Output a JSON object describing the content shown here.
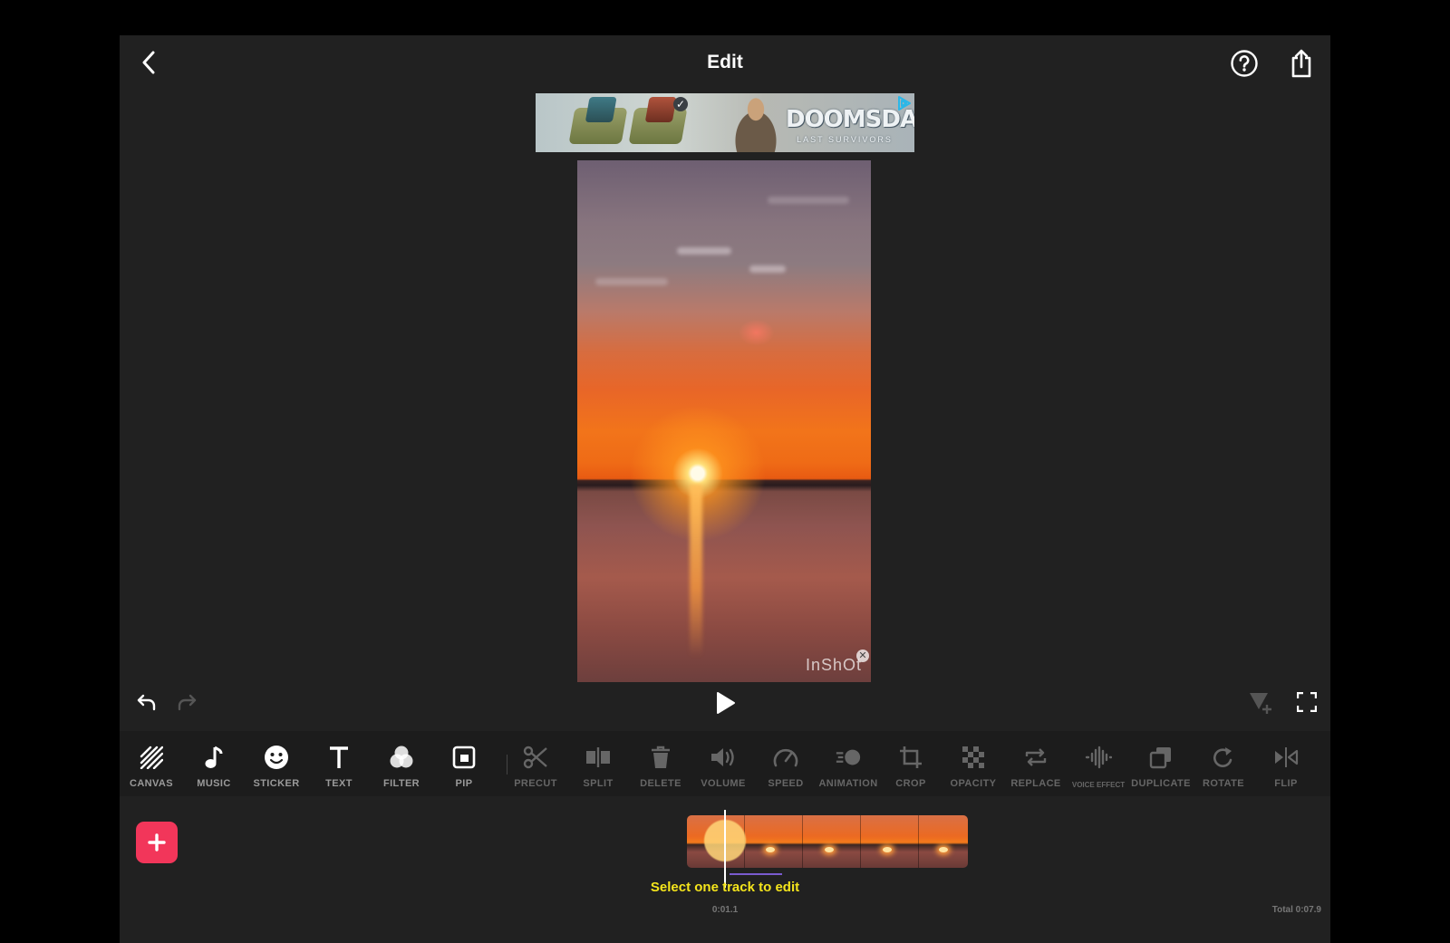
{
  "header": {
    "title": "Edit"
  },
  "ad": {
    "logo_text": "DOOMSDAY",
    "logo_subtext": "LAST SURVIVORS",
    "accent_color": "#2bb7e8"
  },
  "preview": {
    "watermark": "InShOt"
  },
  "toolbar": {
    "tools": [
      {
        "label": "CANVAS",
        "icon": "canvas-icon"
      },
      {
        "label": "MUSIC",
        "icon": "music-icon"
      },
      {
        "label": "STICKER",
        "icon": "sticker-icon"
      },
      {
        "label": "TEXT",
        "icon": "text-icon"
      },
      {
        "label": "FILTER",
        "icon": "filter-icon"
      },
      {
        "label": "PIP",
        "icon": "pip-icon"
      },
      {
        "label": "PRECUT",
        "icon": "scissors-icon"
      },
      {
        "label": "SPLIT",
        "icon": "split-icon"
      },
      {
        "label": "DELETE",
        "icon": "trash-icon"
      },
      {
        "label": "VOLUME",
        "icon": "volume-icon"
      },
      {
        "label": "SPEED",
        "icon": "speed-icon"
      },
      {
        "label": "ANIMATION",
        "icon": "animation-icon"
      },
      {
        "label": "CROP",
        "icon": "crop-icon"
      },
      {
        "label": "OPACITY",
        "icon": "opacity-icon"
      },
      {
        "label": "REPLACE",
        "icon": "replace-icon"
      },
      {
        "label": "VOICE EFFECT",
        "icon": "voice-effect-icon"
      },
      {
        "label": "DUPLICATE",
        "icon": "duplicate-icon"
      },
      {
        "label": "ROTATE",
        "icon": "rotate-icon"
      },
      {
        "label": "FLIP",
        "icon": "flip-icon"
      }
    ]
  },
  "timeline": {
    "hint": "Select one track to edit",
    "current_time": "0:01.1",
    "total_time": "Total 0:07.9",
    "add_color": "#f2365a",
    "hint_color": "#f5e51c"
  }
}
